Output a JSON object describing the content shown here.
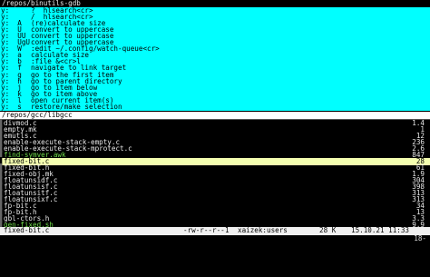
{
  "top_path": "/repos/binutils-gdb",
  "commands": [
    {
      "key": "y:",
      "cmd": "?  hlsearch<cr>"
    },
    {
      "key": "y:",
      "cmd": "/  hlsearch<cr>"
    },
    {
      "key": "y:  A",
      "cmd": "(re)calculate size"
    },
    {
      "key": "y:  U",
      "cmd": "convert to uppercase"
    },
    {
      "key": "y:  UU",
      "cmd": "convert to uppercase"
    },
    {
      "key": "y:  UgU",
      "cmd": "convert to uppercase"
    },
    {
      "key": "y:  W",
      "cmd": ":edit ~/.config/watch-queue<cr>"
    },
    {
      "key": "y:  a",
      "cmd": "calculate size"
    },
    {
      "key": "y:  b",
      "cmd": ":file &<cr>l"
    },
    {
      "key": "y:  f",
      "cmd": "navigate to link target"
    },
    {
      "key": "y:  g",
      "cmd": "go to the first item"
    },
    {
      "key": "y:  h",
      "cmd": "go to parent directory"
    },
    {
      "key": "y:  j",
      "cmd": "go to item below"
    },
    {
      "key": "y:  k",
      "cmd": "go to item above"
    },
    {
      "key": "y:  l",
      "cmd": "open current item(s)"
    },
    {
      "key": "y:  s",
      "cmd": "restore/make selection"
    }
  ],
  "bottom_path": "/repos/gcc/libgcc",
  "files": [
    {
      "name": "divmod.c",
      "size": "1.4",
      "type": "file"
    },
    {
      "name": "empty.mk",
      "size": "1",
      "type": "file"
    },
    {
      "name": "emutls.c",
      "size": "12",
      "type": "file"
    },
    {
      "name": "enable-execute-stack-empty.c",
      "size": "236",
      "type": "file"
    },
    {
      "name": "enable-execute-stack-mprotect.c",
      "size": "2.6",
      "type": "file"
    },
    {
      "name": "find-symver.awk",
      "size": "847",
      "type": "exe"
    },
    {
      "name": "fixed-bit.c",
      "size": "28",
      "type": "sel"
    },
    {
      "name": "fixed-bit.h",
      "size": "61",
      "type": "file"
    },
    {
      "name": "fixed-obj.mk",
      "size": "1.9",
      "type": "file"
    },
    {
      "name": "floatunsidf.c",
      "size": "304",
      "type": "file"
    },
    {
      "name": "floatunsisf.c",
      "size": "398",
      "type": "file"
    },
    {
      "name": "floatunsitf.c",
      "size": "313",
      "type": "file"
    },
    {
      "name": "floatunsixf.c",
      "size": "313",
      "type": "file"
    },
    {
      "name": "fp-bit.c",
      "size": "34",
      "type": "file"
    },
    {
      "name": "fp-bit.h",
      "size": "13",
      "type": "file"
    },
    {
      "name": "gbl-ctors.h",
      "size": "3.3",
      "type": "file"
    },
    {
      "name": "gen-fixed.sh",
      "size": "9.9",
      "type": "exe"
    }
  ],
  "status": {
    "file": "fixed-bit.c",
    "perms": "-rw-r--r--",
    "count": "1",
    "owner": "xaizek:users",
    "size": "28 K",
    "datetime": "15.10.21 11:33",
    "position": "18-"
  }
}
